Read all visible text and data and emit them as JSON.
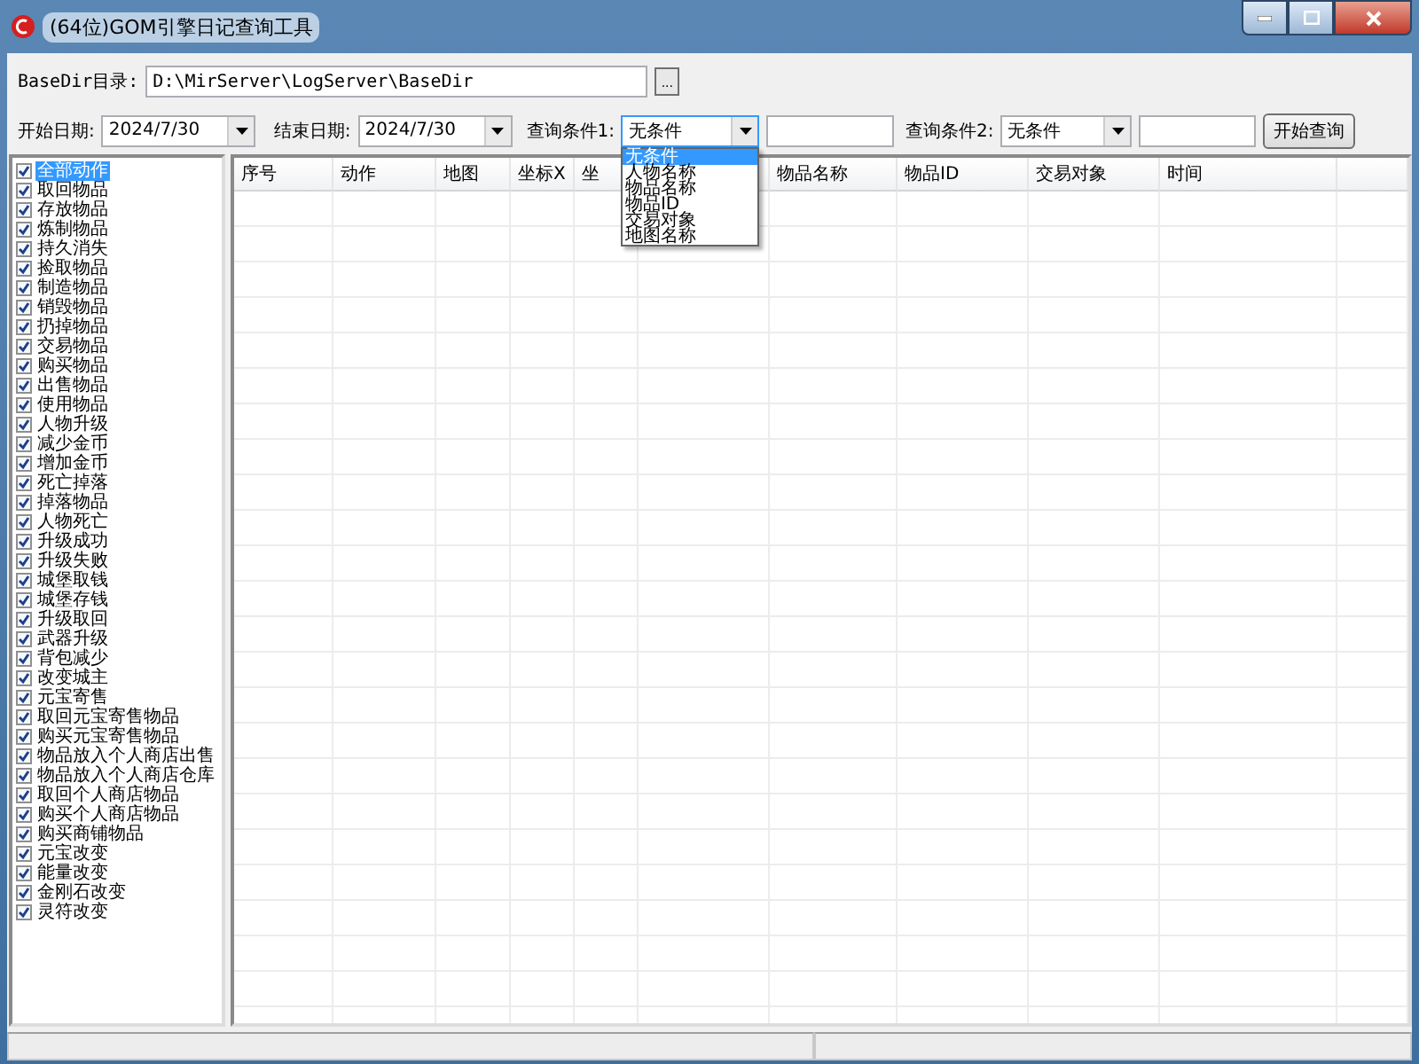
{
  "window": {
    "title": "(64位)GOM引擎日记查询工具"
  },
  "basedir": {
    "label": "BaseDir目录:",
    "value": "D:\\MirServer\\LogServer\\BaseDir",
    "browse": "..."
  },
  "filters": {
    "start_label": "开始日期:",
    "start_value": "2024/7/30",
    "end_label": "结束日期:",
    "end_value": "2024/7/30",
    "cond1_label": "查询条件1:",
    "cond1_value": "无条件",
    "cond1_expanded": true,
    "cond1_options": [
      {
        "label": "无条件",
        "selected": true
      },
      {
        "label": "人物名称",
        "selected": false
      },
      {
        "label": "物品名称",
        "selected": false
      },
      {
        "label": "物品ID",
        "selected": false
      },
      {
        "label": "交易对象",
        "selected": false
      },
      {
        "label": "地图名称",
        "selected": false
      }
    ],
    "cond2_label": "查询条件2:",
    "cond2_value": "无条件",
    "search_button": "开始查询"
  },
  "actions": [
    {
      "label": "全部动作",
      "checked": true,
      "selected": true
    },
    {
      "label": "取回物品",
      "checked": true,
      "selected": false
    },
    {
      "label": "存放物品",
      "checked": true,
      "selected": false
    },
    {
      "label": "炼制物品",
      "checked": true,
      "selected": false
    },
    {
      "label": "持久消失",
      "checked": true,
      "selected": false
    },
    {
      "label": "捡取物品",
      "checked": true,
      "selected": false
    },
    {
      "label": "制造物品",
      "checked": true,
      "selected": false
    },
    {
      "label": "销毁物品",
      "checked": true,
      "selected": false
    },
    {
      "label": "扔掉物品",
      "checked": true,
      "selected": false
    },
    {
      "label": "交易物品",
      "checked": true,
      "selected": false
    },
    {
      "label": "购买物品",
      "checked": true,
      "selected": false
    },
    {
      "label": "出售物品",
      "checked": true,
      "selected": false
    },
    {
      "label": "使用物品",
      "checked": true,
      "selected": false
    },
    {
      "label": "人物升级",
      "checked": true,
      "selected": false
    },
    {
      "label": "减少金币",
      "checked": true,
      "selected": false
    },
    {
      "label": "增加金币",
      "checked": true,
      "selected": false
    },
    {
      "label": "死亡掉落",
      "checked": true,
      "selected": false
    },
    {
      "label": "掉落物品",
      "checked": true,
      "selected": false
    },
    {
      "label": "人物死亡",
      "checked": true,
      "selected": false
    },
    {
      "label": "升级成功",
      "checked": true,
      "selected": false
    },
    {
      "label": "升级失败",
      "checked": true,
      "selected": false
    },
    {
      "label": "城堡取钱",
      "checked": true,
      "selected": false
    },
    {
      "label": "城堡存钱",
      "checked": true,
      "selected": false
    },
    {
      "label": "升级取回",
      "checked": true,
      "selected": false
    },
    {
      "label": "武器升级",
      "checked": true,
      "selected": false
    },
    {
      "label": "背包减少",
      "checked": true,
      "selected": false
    },
    {
      "label": "改变城主",
      "checked": true,
      "selected": false
    },
    {
      "label": "元宝寄售",
      "checked": true,
      "selected": false
    },
    {
      "label": "取回元宝寄售物品",
      "checked": true,
      "selected": false
    },
    {
      "label": "购买元宝寄售物品",
      "checked": true,
      "selected": false
    },
    {
      "label": "物品放入个人商店出售",
      "checked": true,
      "selected": false
    },
    {
      "label": "物品放入个人商店仓库",
      "checked": true,
      "selected": false
    },
    {
      "label": "取回个人商店物品",
      "checked": true,
      "selected": false
    },
    {
      "label": "购买个人商店物品",
      "checked": true,
      "selected": false
    },
    {
      "label": "购买商铺物品",
      "checked": true,
      "selected": false
    },
    {
      "label": "元宝改变",
      "checked": true,
      "selected": false
    },
    {
      "label": "能量改变",
      "checked": true,
      "selected": false
    },
    {
      "label": "金刚石改变",
      "checked": true,
      "selected": false
    },
    {
      "label": "灵符改变",
      "checked": true,
      "selected": false
    }
  ],
  "table": {
    "columns": [
      "序号",
      "动作",
      "地图",
      "坐标X",
      "坐",
      null,
      "物品名称",
      "物品ID",
      "交易对象",
      "时间"
    ]
  }
}
